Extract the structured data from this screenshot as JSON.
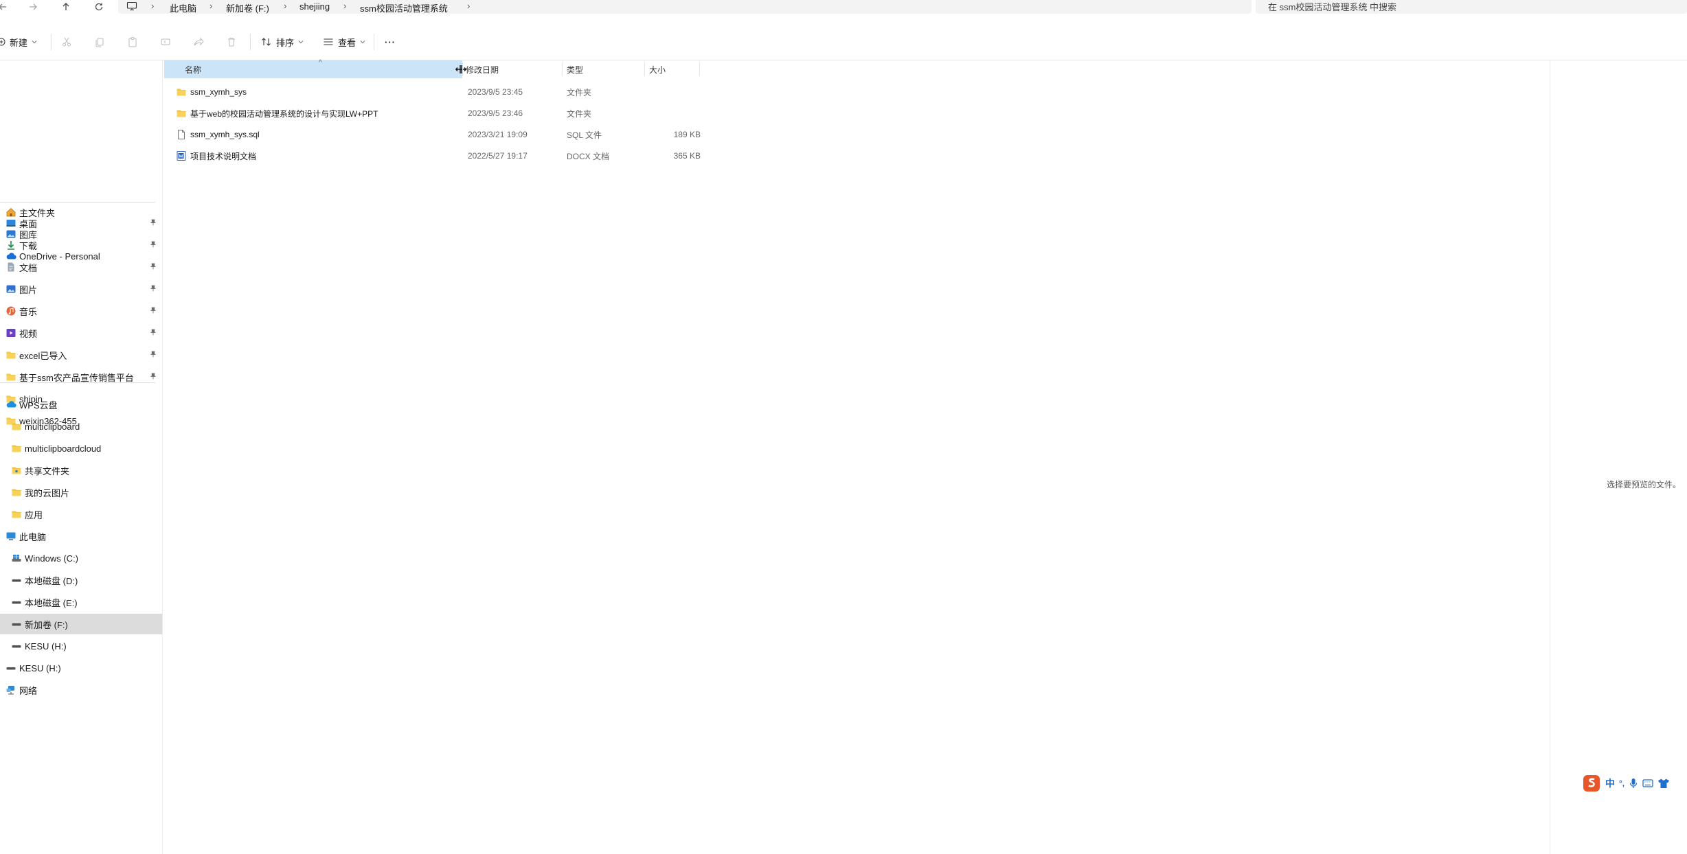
{
  "address": {
    "breadcrumb": [
      "此电脑",
      "新加卷 (F:)",
      "shejiing",
      "ssm校园活动管理系统"
    ],
    "search_placeholder": "在 ssm校园活动管理系统 中搜索"
  },
  "toolbar": {
    "new_label": "新建",
    "sort_label": "排序",
    "view_label": "查看",
    "more_label": "···"
  },
  "sidebar": {
    "quick": [
      {
        "label": "主文件夹",
        "icon": "home-icon"
      },
      {
        "label": "图库",
        "icon": "gallery-icon"
      },
      {
        "label": "OneDrive - Personal",
        "icon": "cloud-icon"
      }
    ],
    "pinned": [
      {
        "label": "桌面",
        "icon": "desktop-icon",
        "pinned": true
      },
      {
        "label": "下载",
        "icon": "download-icon",
        "pinned": true
      },
      {
        "label": "文档",
        "icon": "document-icon",
        "pinned": true
      },
      {
        "label": "图片",
        "icon": "pictures-icon",
        "pinned": true
      },
      {
        "label": "音乐",
        "icon": "music-icon",
        "pinned": true
      },
      {
        "label": "视频",
        "icon": "video-icon",
        "pinned": true
      },
      {
        "label": "excel已导入",
        "icon": "folder-icon",
        "pinned": true
      },
      {
        "label": "基于ssm农产品宣传销售平台",
        "icon": "folder-icon",
        "pinned": true
      },
      {
        "label": "shipin",
        "icon": "folder-icon",
        "pinned": false
      },
      {
        "label": "weixin362-455",
        "icon": "folder-icon",
        "pinned": false
      }
    ],
    "wps": {
      "label": "WPS云盘",
      "icon": "wps-cloud-icon"
    },
    "wps_children": [
      "multiclipboard",
      "multiclipboardcloud",
      "共享文件夹",
      "我的云图片",
      "应用"
    ],
    "pc": {
      "label": "此电脑",
      "icon": "computer-icon"
    },
    "drives": [
      "Windows (C:)",
      "本地磁盘 (D:)",
      "本地磁盘 (E:)",
      "新加卷 (F:)",
      "KESU  (H:)"
    ],
    "selected_drive": "新加卷 (F:)",
    "usb": "KESU  (H:)",
    "network": "网络"
  },
  "columns": {
    "name": "名称",
    "date": "修改日期",
    "type": "类型",
    "size": "大小"
  },
  "files": [
    {
      "name": "ssm_xymh_sys",
      "date": "2023/9/5 23:45",
      "type": "文件夹",
      "size": "",
      "icon": "folder-icon"
    },
    {
      "name": "基于web的校园活动管理系统的设计与实现LW+PPT",
      "date": "2023/9/5 23:46",
      "type": "文件夹",
      "size": "",
      "icon": "folder-icon"
    },
    {
      "name": "ssm_xymh_sys.sql",
      "date": "2023/3/21 19:09",
      "type": "SQL 文件",
      "size": "189 KB",
      "icon": "file-icon"
    },
    {
      "name": "项目技术说明文档",
      "date": "2022/5/27 19:17",
      "type": "DOCX 文档",
      "size": "365 KB",
      "icon": "word-doc-icon"
    }
  ],
  "preview": {
    "message": "选择要预览的文件。"
  },
  "ime": {
    "mode": "中",
    "punct": "°,"
  },
  "colors": {
    "folder": "#f4c542",
    "selection": "#dcdcdc",
    "header_sorted": "#cce4f7",
    "accent": "#1e6fd0",
    "sogou": "#e8562a"
  }
}
